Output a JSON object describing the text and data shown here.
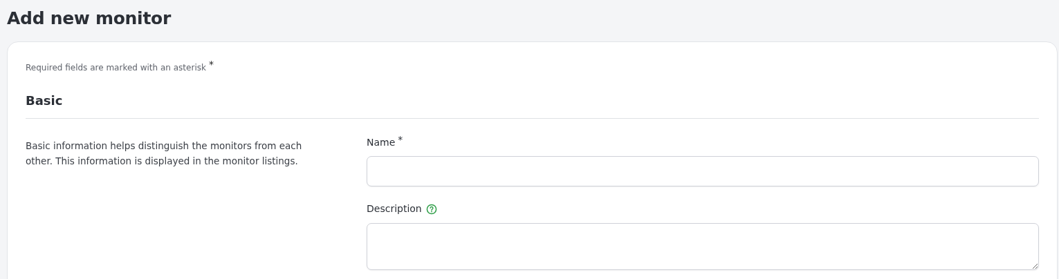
{
  "page": {
    "title": "Add new monitor"
  },
  "form": {
    "required_note": "Required fields are marked with an asterisk",
    "required_note_mark": "*",
    "sections": [
      {
        "heading": "Basic",
        "description": "Basic information helps distinguish the monitors from each other. This information is displayed in the monitor listings.",
        "fields": [
          {
            "kind": "input",
            "label": "Name",
            "required_mark": "*",
            "help": false
          },
          {
            "kind": "textarea",
            "label": "Description",
            "help": true
          }
        ]
      }
    ]
  }
}
